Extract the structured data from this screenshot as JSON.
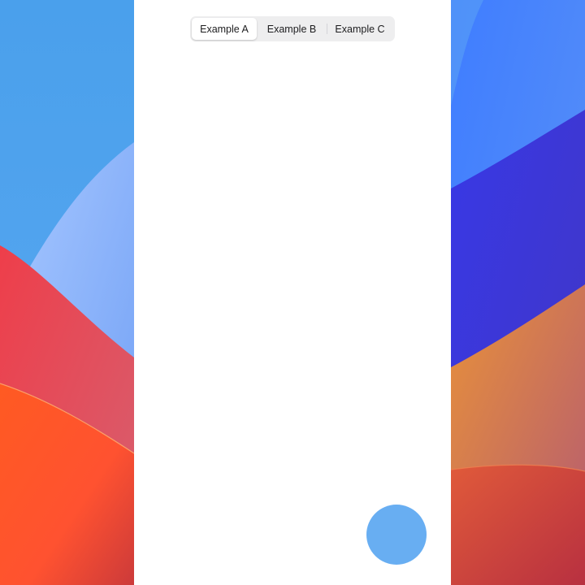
{
  "segmented_control": {
    "options": [
      {
        "label": "Example A",
        "selected": true
      },
      {
        "label": "Example B",
        "selected": false
      },
      {
        "label": "Example C",
        "selected": false
      }
    ]
  },
  "floating_button": {
    "color": "#68aef2"
  },
  "colors": {
    "panel_background": "#ffffff",
    "segmented_background": "#eeeeef",
    "wallpaper_blue": "#4aa0ec",
    "wallpaper_red": "#e8474f",
    "wallpaper_orange": "#ff5a26",
    "wallpaper_indigo": "#3a37d8"
  }
}
